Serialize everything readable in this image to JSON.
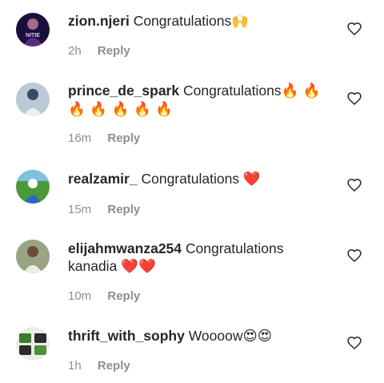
{
  "comments": [
    {
      "username": "zion.njeri",
      "text": "Congratulations",
      "emoji": "🙌",
      "time": "2h",
      "reply": "Reply",
      "avatar_icon": "profile-avatar-icon"
    },
    {
      "username": "prince_de_spark",
      "text": "Congratulations",
      "emoji": "🔥 🔥 🔥 🔥 🔥 🔥 🔥",
      "time": "16m",
      "reply": "Reply",
      "avatar_icon": "profile-avatar-icon"
    },
    {
      "username": "realzamir_",
      "text": "Congratulations",
      "emoji": "❤️",
      "time": "15m",
      "reply": "Reply",
      "avatar_icon": "profile-avatar-icon"
    },
    {
      "username": "elijahmwanza254",
      "text": "Congratulations kanadia",
      "emoji": "❤️❤️",
      "time": "10m",
      "reply": "Reply",
      "avatar_icon": "profile-avatar-icon"
    },
    {
      "username": "thrift_with_sophy",
      "text": "Woooow",
      "emoji": "😍😍",
      "time": "1h",
      "reply": "Reply",
      "avatar_icon": "profile-avatar-icon"
    }
  ],
  "avatar_1_caption": "NITIE",
  "colors": {
    "text": "#262626",
    "meta": "#8e8e8e",
    "heart_outline": "#262626",
    "emoji_heart": "#e0162b",
    "emoji_fire": "#f28b22"
  }
}
